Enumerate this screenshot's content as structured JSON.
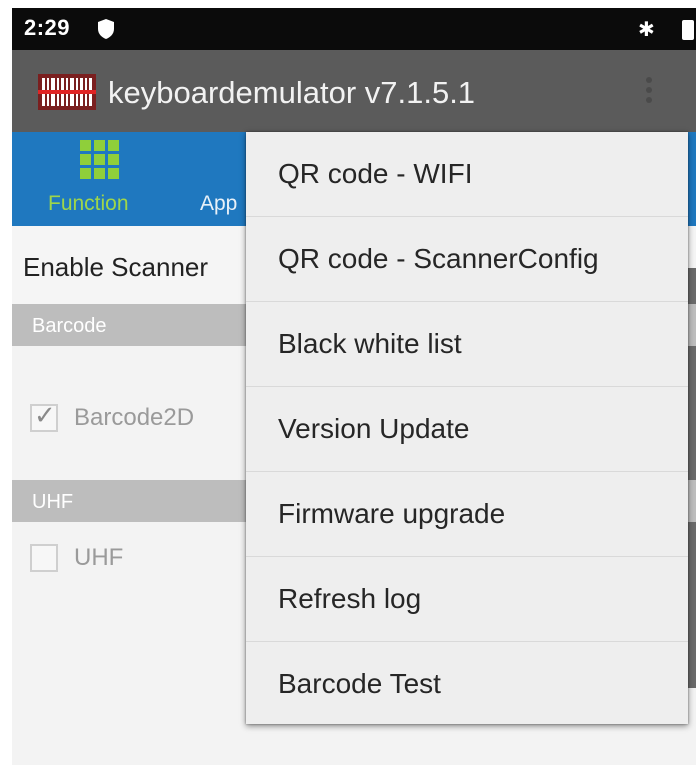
{
  "status_bar": {
    "time": "2:29",
    "icons": [
      "shield-icon",
      "bluetooth-icon",
      "battery-icon"
    ]
  },
  "app_bar": {
    "title": "keyboardemulator v7.1.5.1",
    "logo_icon": "barcode-logo-icon",
    "overflow_icon": "more-vert-icon"
  },
  "tabs": [
    {
      "label": "Function",
      "icon": "grid-icon",
      "active": true
    },
    {
      "label": "App",
      "active": false
    }
  ],
  "content": {
    "enable_label": "Enable Scanner",
    "sections": [
      {
        "title": "Barcode",
        "checkbox": {
          "label": "Barcode2D",
          "checked": true
        }
      },
      {
        "title": "UHF",
        "checkbox": {
          "label": "UHF",
          "checked": false
        }
      }
    ]
  },
  "menu": {
    "items": [
      "QR code - WIFI",
      "QR code - ScannerConfig",
      "Black white list",
      "Version Update",
      "Firmware upgrade",
      "Refresh log",
      "Barcode Test"
    ]
  },
  "colors": {
    "status_bar": "#0b0b0b",
    "app_bar": "#5b5b5b",
    "tab_bar": "#1f78bf",
    "active_tab": "#9fd64a",
    "section_header": "#bdbdbd",
    "menu_bg": "#eeeeee"
  }
}
